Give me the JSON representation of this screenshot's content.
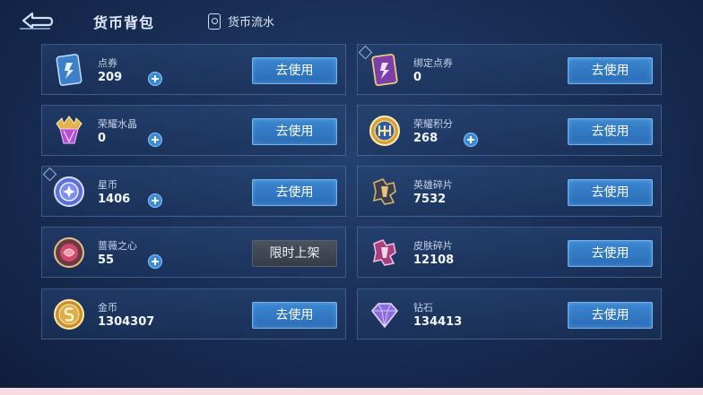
{
  "header": {
    "title": "货币背包",
    "flow_label": "货币流水"
  },
  "currencies": [
    {
      "name": "点券",
      "value": "209",
      "action": "去使用",
      "icon": "ticket-card-icon"
    },
    {
      "name": "绑定点券",
      "value": "0",
      "action": "去使用",
      "icon": "bound-ticket-card-icon"
    },
    {
      "name": "荣耀水晶",
      "value": "0",
      "action": "去使用",
      "icon": "glory-crystal-icon"
    },
    {
      "name": "荣耀积分",
      "value": "268",
      "action": "去使用",
      "icon": "glory-points-coin-icon"
    },
    {
      "name": "星币",
      "value": "1406",
      "action": "去使用",
      "icon": "star-coin-icon"
    },
    {
      "name": "英雄碎片",
      "value": "7532",
      "action": "去使用",
      "icon": "hero-fragment-icon"
    },
    {
      "name": "蔷薇之心",
      "value": "55",
      "action": "限时上架",
      "icon": "rose-heart-icon"
    },
    {
      "name": "皮肤碎片",
      "value": "12108",
      "action": "去使用",
      "icon": "skin-fragment-icon"
    },
    {
      "name": "金币",
      "value": "1304307",
      "action": "去使用",
      "icon": "gold-coin-icon"
    },
    {
      "name": "钻石",
      "value": "134413",
      "action": "去使用",
      "icon": "diamond-icon"
    }
  ]
}
